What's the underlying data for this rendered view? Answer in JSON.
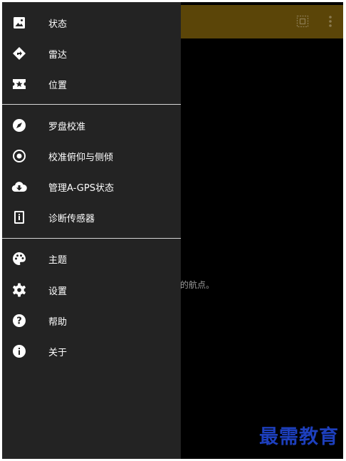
{
  "drawer": {
    "items": [
      {
        "label": "状态",
        "icon": "image-icon"
      },
      {
        "label": "雷达",
        "icon": "navigation-diamond-icon"
      },
      {
        "label": "位置",
        "icon": "ticket-star-icon"
      },
      {
        "label": "罗盘校准",
        "icon": "compass-icon"
      },
      {
        "label": "校准俯仰与侧倾",
        "icon": "target-icon"
      },
      {
        "label": "管理A-GPS状态",
        "icon": "cloud-download-icon"
      },
      {
        "label": "诊断传感器",
        "icon": "info-device-icon"
      },
      {
        "label": "主题",
        "icon": "palette-icon"
      },
      {
        "label": "设置",
        "icon": "gear-icon"
      },
      {
        "label": "帮助",
        "icon": "help-icon"
      },
      {
        "label": "关于",
        "icon": "info-icon"
      }
    ]
  },
  "main": {
    "hint_text": "的航点。"
  },
  "appbar": {
    "actions": [
      "select-all-icon",
      "more-vert-icon"
    ]
  },
  "watermark": "最需教育"
}
